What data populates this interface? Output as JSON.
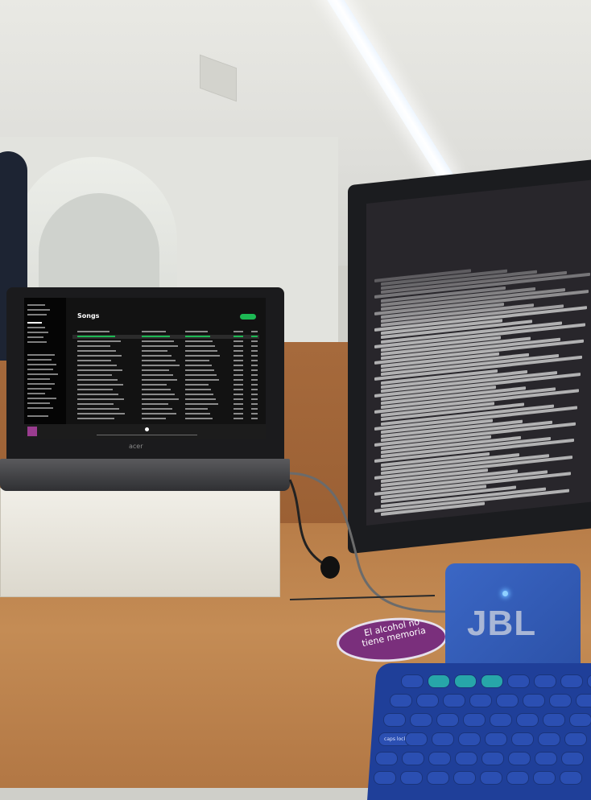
{
  "laptop": {
    "brand": "acer",
    "spotify_window": {
      "header_title": "Songs",
      "accent_color": "#1db954"
    }
  },
  "monitor": {
    "terminal_text_color": "#dcdcdc"
  },
  "sticker": {
    "line1": "El alcohol",
    "line2": "no",
    "line3": "tiene",
    "line4": "memoria",
    "color": "#7a2f7c"
  },
  "speaker": {
    "brand": "JBL",
    "color": "#3b67c5"
  },
  "keyboard": {
    "color": "#1f3f99",
    "caps_label": "caps lock"
  }
}
